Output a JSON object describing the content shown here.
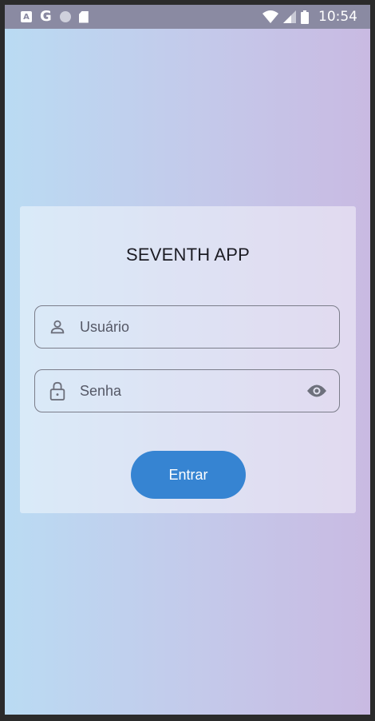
{
  "status_bar": {
    "time": "10:54",
    "left_icons": [
      "a-notification-icon",
      "google-icon",
      "circle-icon",
      "sd-card-icon"
    ],
    "right_icons": [
      "wifi-icon",
      "signal-icon",
      "battery-icon"
    ],
    "a_icon_text": "A",
    "g_icon_text": "G"
  },
  "login": {
    "title": "SEVENTH APP",
    "username": {
      "placeholder": "Usuário",
      "icon": "person-icon"
    },
    "password": {
      "placeholder": "Senha",
      "icon": "lock-icon",
      "toggle_icon": "eye-icon"
    },
    "submit_label": "Entrar"
  },
  "colors": {
    "status_bar": "#8a8aa2",
    "gradient_start": "#badbf3",
    "gradient_end": "#c9bae2",
    "button": "#3684d2",
    "field_border": "#7b7d8a"
  }
}
